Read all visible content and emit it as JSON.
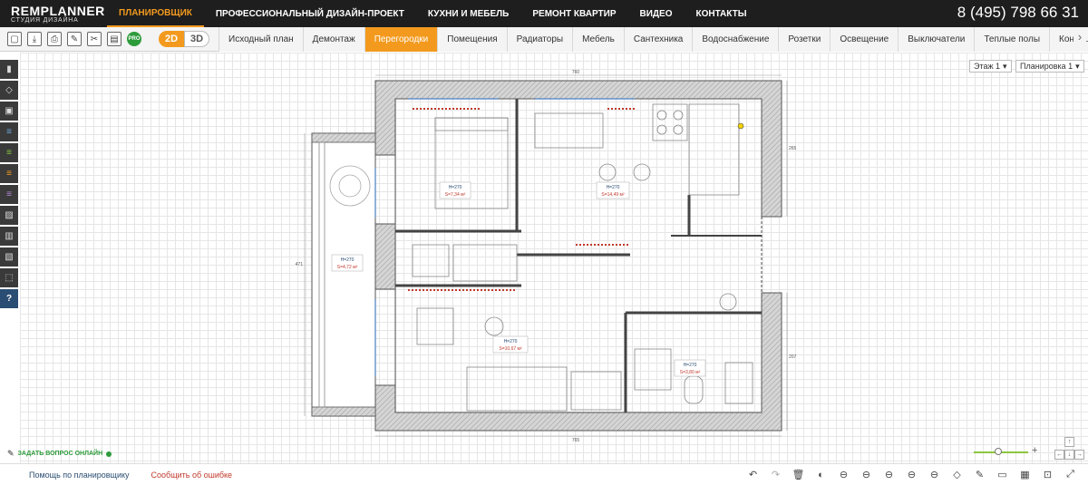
{
  "header": {
    "logo_main": "REMPLANNER",
    "logo_sub": "СТУДИЯ ДИЗАЙНА",
    "nav": [
      "ПЛАНИРОВЩИК",
      "ПРОФЕССИОНАЛЬНЫЙ ДИЗАЙН-ПРОЕКТ",
      "КУХНИ И МЕБЕЛЬ",
      "РЕМОНТ КВАРТИР",
      "ВИДЕО",
      "КОНТАКТЫ"
    ],
    "phone": "8 (495) 798 66 31"
  },
  "toolbar": {
    "pro_badge": "PRO",
    "mode_2d": "2D",
    "mode_3d": "3D",
    "tabs": [
      "Исходный план",
      "Демонтаж",
      "Перегородки",
      "Помещения",
      "Радиаторы",
      "Мебель",
      "Сантехника",
      "Водоснабжение",
      "Розетки",
      "Освещение",
      "Выключатели",
      "Теплые полы",
      "Кондиционе"
    ],
    "active_tab": "Перегородки"
  },
  "selectors": {
    "floor": "Этаж 1",
    "layout": "Планировка 1"
  },
  "plan": {
    "dims": {
      "top": "760",
      "bottom": "765",
      "left": "471",
      "right": "265",
      "right2": "207"
    },
    "rooms": [
      {
        "h": "H=270",
        "s": "S=7,34 м²"
      },
      {
        "h": "H=270",
        "s": "S=14,49 м²"
      },
      {
        "h": "H=270",
        "s": "S=4,72 м²"
      },
      {
        "h": "H=270",
        "s": "S=10,67 м²"
      },
      {
        "h": "H=270",
        "s": "S=3,80 м²"
      }
    ]
  },
  "ask": {
    "label": "ЗАДАТЬ ВОПРОС ОНЛАЙН"
  },
  "footer": {
    "help": "Помощь по планировщику",
    "report": "Сообщить об ошибке"
  },
  "zoom": {
    "level": 0.45
  }
}
